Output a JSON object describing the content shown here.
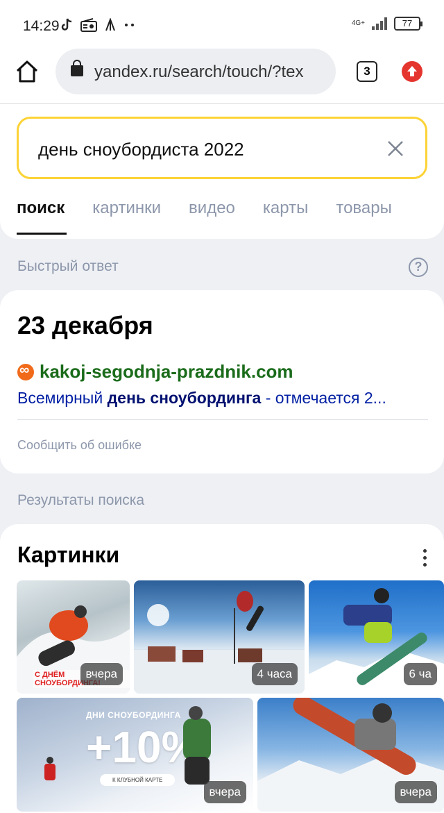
{
  "status_bar": {
    "time": "14:29",
    "network": "4G+",
    "battery": "77"
  },
  "browser": {
    "url": "yandex.ru/search/touch/?tex",
    "tab_count": "3"
  },
  "search": {
    "query": "день сноубордиста 2022",
    "tabs": [
      "поиск",
      "картинки",
      "видео",
      "карты",
      "товары"
    ],
    "active_tab": "поиск"
  },
  "quick_answer": {
    "section_label": "Быстрый ответ",
    "help_label": "?",
    "title": "23 декабря",
    "source_domain": "kakoj-segodnja-prazdnik.com",
    "snippet_pre": "Всемирный ",
    "snippet_bold": "день сноубординга",
    "snippet_post": " - отмечается 2...",
    "report_label": "Сообщить об ошибке"
  },
  "results": {
    "section_label": "Результаты поиска"
  },
  "images": {
    "title": "Картинки",
    "items": [
      {
        "badge": "вчера",
        "caption": "С ДНЁМ СНОУБОРДИНГА!"
      },
      {
        "badge": "4 часа"
      },
      {
        "badge": "6 ча"
      },
      {
        "badge": "вчера",
        "promo_top": "ДНИ СНОУБОРДИНГА",
        "promo_big": "+10%",
        "promo_card": "К КЛУБНОЙ КАРТЕ"
      },
      {
        "badge": "вчера"
      }
    ]
  },
  "colors": {
    "search_border": "#fcd336",
    "domain_green": "#1a6b1a",
    "snippet_blue": "#001fa3",
    "muted": "#8d97ab"
  }
}
